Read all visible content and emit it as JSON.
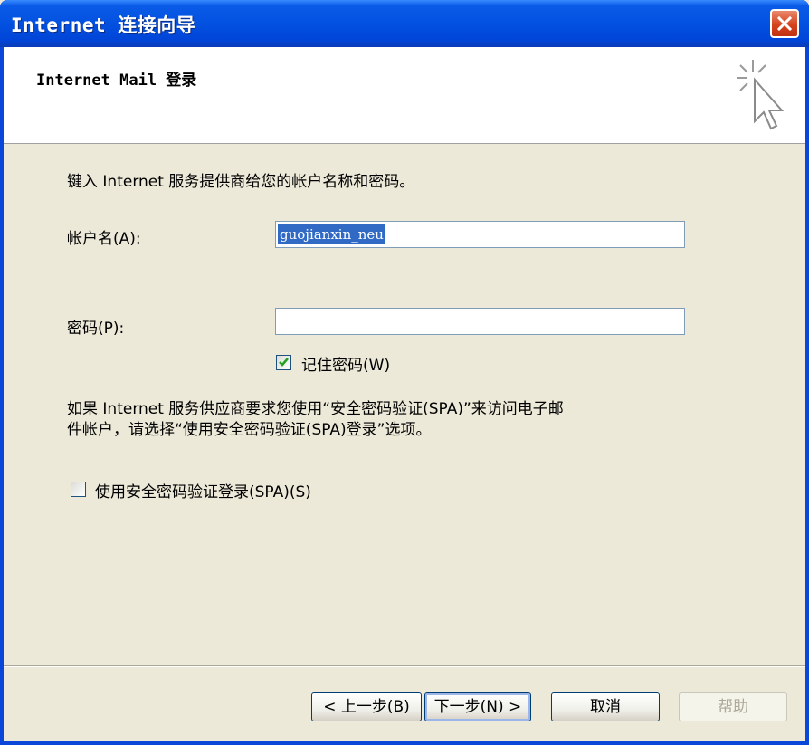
{
  "window": {
    "title": "Internet 连接向导"
  },
  "header": {
    "title": "Internet Mail 登录"
  },
  "main": {
    "instruction": "键入 Internet 服务提供商给您的帐户名称和密码。",
    "account_label": "帐户名(A):",
    "account_value": "guojianxin_neu",
    "password_label": "密码(P):",
    "password_value": "",
    "remember_label": "记住密码(W)",
    "remember_checked": true,
    "spa_note_line1": "如果 Internet 服务供应商要求您使用“安全密码验证(SPA)”来访问电子邮",
    "spa_note_line2": "件帐户，请选择“使用安全密码验证(SPA)登录”选项。",
    "spa_label": "使用安全密码验证登录(SPA)(S)",
    "spa_checked": false
  },
  "buttons": {
    "back": "< 上一步(B)",
    "next": "下一步(N) >",
    "cancel": "取消",
    "help": "帮助"
  },
  "icons": {
    "close": "close-icon",
    "wizard": "wizard-cursor-icon",
    "check": "checkmark-icon"
  },
  "colors": {
    "titlebar": "#0351e0",
    "dialog_bg": "#ece9d8",
    "selection": "#316ac5",
    "close_button": "#d5431d"
  }
}
